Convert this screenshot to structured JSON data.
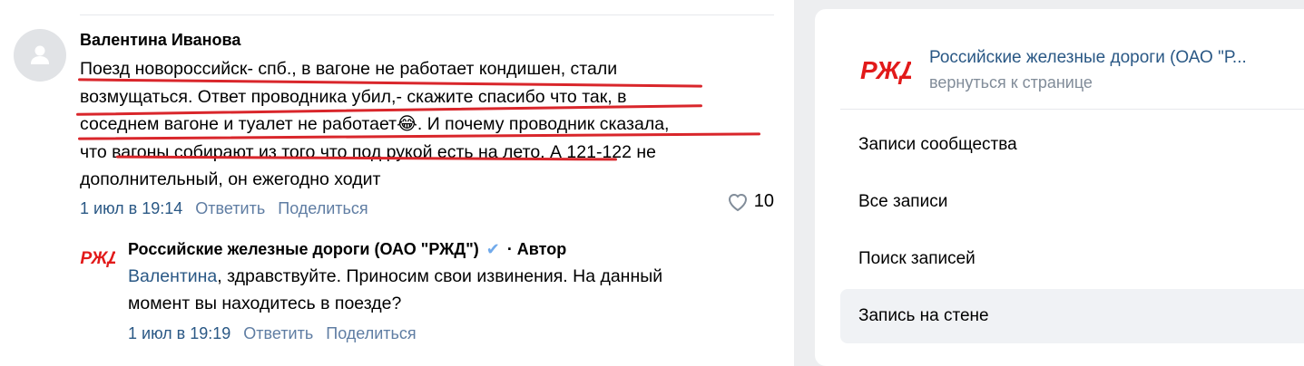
{
  "comment": {
    "author": "Валентина Иванова",
    "lines": [
      "Поезд новороссийск- спб., в вагоне не работает кондишен, стали",
      "возмущаться. Ответ проводника убил,- скажите спасибо что так, в",
      "соседнем вагоне и туалет не работает😂. И почему проводник сказала,",
      "что вагоны собирают из того что под рукой есть на лето. А 121-122 не",
      "дополнительный, он ежегодно ходит"
    ],
    "date": "1 июл в 19:14",
    "reply_label": "Ответить",
    "share_label": "Поделиться",
    "likes": "10"
  },
  "reply": {
    "author": "Российские железные дороги (ОАО \"РЖД\")",
    "role": "· Автор",
    "mention": "Валентина",
    "text_after_mention": ", здравствуйте. Приносим свои извинения. На данный",
    "text_line2": "момент вы находитесь в поезде?",
    "date": "1 июл в 19:19",
    "reply_label": "Ответить",
    "share_label": "Поделиться"
  },
  "sidebar": {
    "group_name": "Российские железные дороги (ОАО \"Р...",
    "group_sub": "вернуться к странице",
    "menu": [
      {
        "label": "Записи сообщества"
      },
      {
        "label": "Все записи"
      },
      {
        "label": "Поиск записей"
      },
      {
        "label": "Запись на стене"
      }
    ]
  },
  "logo_text": "РЖД",
  "colors": {
    "accent": "#2a5885",
    "meta": "#818c99",
    "underline": "#d9262b",
    "logo_red": "#e21a1a"
  }
}
